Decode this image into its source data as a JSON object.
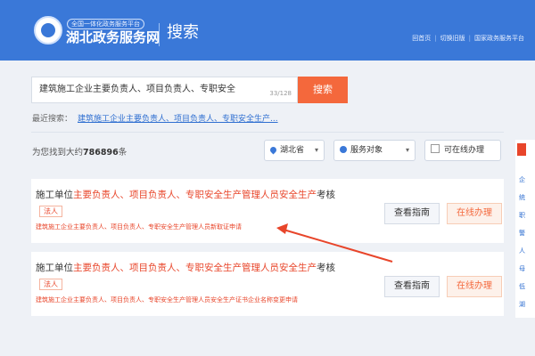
{
  "header": {
    "platform_sub": "全国一体化政务服务平台",
    "platform_name": "湖北政务服务网",
    "page_title": "搜索",
    "links": [
      "回首页",
      "切换旧版",
      "国家政务服务平台"
    ]
  },
  "search": {
    "value": "建筑施工企业主要负责人、项目负责人、专职安全",
    "count": "33/128",
    "button_label": "搜索"
  },
  "recent": {
    "label": "最近搜索：",
    "item": "建筑施工企业主要负责人、项目负责人、专职安全生产..."
  },
  "results": {
    "prefix": "为您找到大约",
    "count": "786896",
    "suffix": "条"
  },
  "filters": {
    "region": "湖北省",
    "target": "服务对象",
    "online": "可在线办理"
  },
  "cards": [
    {
      "title_pre": "施工单位",
      "title_hl": "主要负责人、项目负责人、专职安全生产管理人员安全生产",
      "title_post": "考核",
      "tag": "法人",
      "sub": "建筑施工企业主要负责人、项目负责人、专职安全生产管理人员新取证申请",
      "guide_label": "查看指南",
      "online_label": "在线办理"
    },
    {
      "title_pre": "施工单位",
      "title_hl": "主要负责人、项目负责人、专职安全生产管理人员安全生产",
      "title_post": "考核",
      "tag": "法人",
      "sub": "建筑施工企业主要负责人、项目负责人、专职安全生产管理人员安全生产证书企业名称变更申请",
      "guide_label": "查看指南",
      "online_label": "在线办理"
    }
  ],
  "right_panel": {
    "items": [
      "企",
      "统",
      "职",
      "警",
      "人",
      "母",
      "低",
      "湖"
    ]
  },
  "colors": {
    "header_bg": "#3a78d8",
    "accent_orange": "#f4683c",
    "highlight_red": "#e8452a",
    "link_blue": "#2f6fd1"
  }
}
